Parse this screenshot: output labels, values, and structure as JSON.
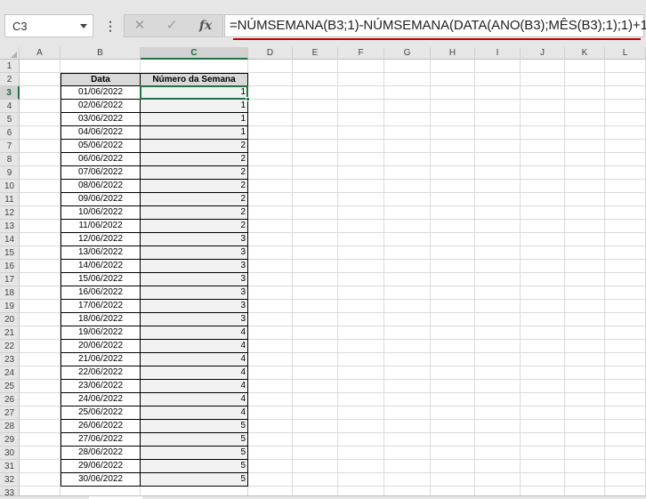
{
  "name_box": {
    "value": "C3"
  },
  "formula_bar": {
    "cancel_icon": "✕",
    "enter_icon": "✓",
    "function_icon": "fx",
    "formula": "=NÚMSEMANA(B3;1)-NÚMSEMANA(DATA(ANO(B3);MÊS(B3);1);1)+1"
  },
  "columns": [
    "A",
    "B",
    "C",
    "D",
    "E",
    "F",
    "G",
    "H",
    "I",
    "J",
    "K",
    "L"
  ],
  "active_column": "C",
  "active_row": 3,
  "row_count": 33,
  "table": {
    "headers": {
      "date": "Data",
      "week": "Número da Semana"
    },
    "rows": [
      {
        "date": "01/06/2022",
        "week": 1
      },
      {
        "date": "02/06/2022",
        "week": 1
      },
      {
        "date": "03/06/2022",
        "week": 1
      },
      {
        "date": "04/06/2022",
        "week": 1
      },
      {
        "date": "05/06/2022",
        "week": 2
      },
      {
        "date": "06/06/2022",
        "week": 2
      },
      {
        "date": "07/06/2022",
        "week": 2
      },
      {
        "date": "08/06/2022",
        "week": 2
      },
      {
        "date": "09/06/2022",
        "week": 2
      },
      {
        "date": "10/06/2022",
        "week": 2
      },
      {
        "date": "11/06/2022",
        "week": 2
      },
      {
        "date": "12/06/2022",
        "week": 3
      },
      {
        "date": "13/06/2022",
        "week": 3
      },
      {
        "date": "14/06/2022",
        "week": 3
      },
      {
        "date": "15/06/2022",
        "week": 3
      },
      {
        "date": "16/06/2022",
        "week": 3
      },
      {
        "date": "17/06/2022",
        "week": 3
      },
      {
        "date": "18/06/2022",
        "week": 3
      },
      {
        "date": "19/06/2022",
        "week": 4
      },
      {
        "date": "20/06/2022",
        "week": 4
      },
      {
        "date": "21/06/2022",
        "week": 4
      },
      {
        "date": "22/06/2022",
        "week": 4
      },
      {
        "date": "23/06/2022",
        "week": 4
      },
      {
        "date": "24/06/2022",
        "week": 4
      },
      {
        "date": "25/06/2022",
        "week": 4
      },
      {
        "date": "26/06/2022",
        "week": 5
      },
      {
        "date": "27/06/2022",
        "week": 5
      },
      {
        "date": "28/06/2022",
        "week": 5
      },
      {
        "date": "29/06/2022",
        "week": 5
      },
      {
        "date": "30/06/2022",
        "week": 5
      }
    ]
  },
  "colors": {
    "accent": "#217346",
    "annotation": "#c00000"
  }
}
